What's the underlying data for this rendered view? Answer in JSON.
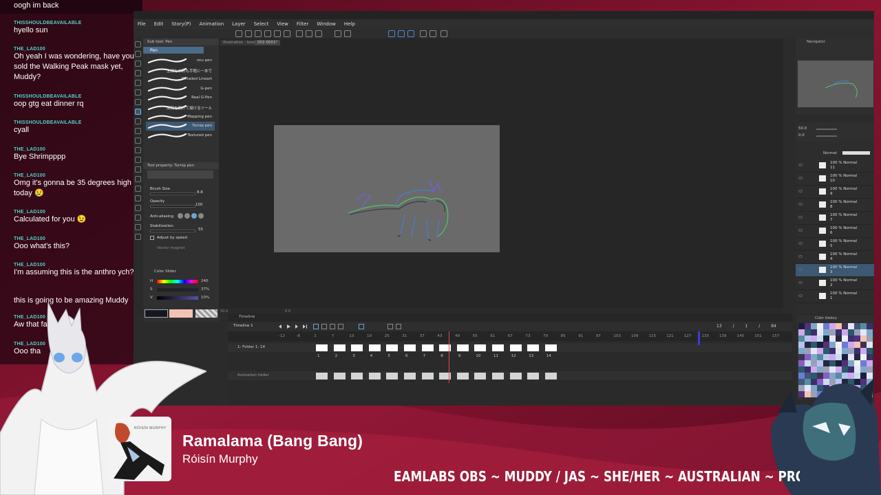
{
  "chat": {
    "messages": [
      {
        "user": "",
        "text": "oogh im back"
      },
      {
        "user": "THISSHOULDBEAVAILABLE",
        "text": "hyello sun"
      },
      {
        "user": "THE_LAD100",
        "text": "Oh yeah I was wondering, have you sold the Walking Peak mask yet, Muddy?"
      },
      {
        "user": "THISSHOULDBEAVAILABLE",
        "text": "oop gtg eat dinner rq"
      },
      {
        "user": "THISSHOULDBEAVAILABLE",
        "text": "cyall"
      },
      {
        "user": "THE_LAD100",
        "text": "Bye Shrimpppp"
      },
      {
        "user": "THE_LAD100",
        "text": "Omg it's gonna be 35 degrees high today 😢"
      },
      {
        "user": "THE_LAD100",
        "text": "Calculated for you 😉"
      },
      {
        "user": "THE_LAD100",
        "text": "Ooo what's this?"
      },
      {
        "user": "THE_LAD100",
        "text": "I'm assuming this is the anthro ych?"
      },
      {
        "user": "",
        "text": "this is going to be amazing Muddy"
      },
      {
        "user": "THE_LAD100",
        "text": "Aw that fa"
      },
      {
        "user": "THE_LAD100",
        "text": "Ooo tha"
      }
    ]
  },
  "app": {
    "menu": [
      "File",
      "Edit",
      "Story(P)",
      "Animation",
      "Layer",
      "Select",
      "View",
      "Filter",
      "Window",
      "Help"
    ],
    "canvas_tabs": [
      "Illustration - bounce",
      "002-0001*"
    ],
    "subtool": {
      "header": "Sub tool: Pen",
      "active": "Pen",
      "brushes": [
        "snu pen",
        "主線も水彩も手軽に一本で",
        "Detailed Lineart",
        "G-pen",
        "Real G-Pen",
        "間隔を開けて描けるツール",
        "Mapping pen",
        "Turnip pen",
        "Textured pen"
      ],
      "selected_brush_index": 7,
      "props_header": "Tool property: Turnip pen",
      "brush_size_label": "Brush Size",
      "brush_size_value": "8.8",
      "opacity_label": "Opacity",
      "opacity_value": "100",
      "antialias_label": "Anti-aliasing",
      "stabilization_label": "Stabilization",
      "stabilization_value": "55",
      "adjust_label": "Adjust by speed",
      "vector_label": "Vector magnet"
    },
    "color_slider": {
      "header": "Color Slider",
      "h_label": "H",
      "h_value": "240",
      "s_label": "S",
      "s_value": "37%",
      "v_label": "V",
      "v_value": "10%"
    },
    "canvas_status": {
      "zoom": "50.0",
      "angle": "0.0"
    },
    "navigator": {
      "header": "Navigator",
      "zoom": "50.0",
      "angle": "0.0"
    },
    "layers": {
      "blend_mode": "Normal",
      "rows": [
        {
          "text": "100 % Normal",
          "name": "11"
        },
        {
          "text": "100 % Normal",
          "name": "10"
        },
        {
          "text": "100 % Normal",
          "name": "9"
        },
        {
          "text": "100 % Normal",
          "name": "8"
        },
        {
          "text": "100 % Normal",
          "name": "7"
        },
        {
          "text": "100 % Normal",
          "name": "6"
        },
        {
          "text": "100 % Normal",
          "name": "5"
        },
        {
          "text": "100 % Normal",
          "name": "4"
        },
        {
          "text": "100 % Normal",
          "name": "3"
        },
        {
          "text": "100 % Normal",
          "name": "2"
        },
        {
          "text": "100 % Normal",
          "name": "1"
        }
      ],
      "selected_index": 8
    },
    "timeline": {
      "tab": "Timeline",
      "name": "Timeline 1",
      "frame_info": [
        "13",
        "/",
        "1",
        "/",
        "84"
      ],
      "ruler": [
        "-12",
        "-6",
        "1",
        "7",
        "13",
        "19",
        "25",
        "31",
        "37",
        "43",
        "49",
        "55",
        "61",
        "67",
        "73",
        "79",
        "85",
        "91",
        "97",
        "103",
        "109",
        "115",
        "121",
        "127",
        "133",
        "139",
        "145",
        "151",
        "157"
      ],
      "track1": "1: Folder 1: 14",
      "track2": "Animation folder",
      "cel_numbers": [
        "1",
        "2",
        "3",
        "4",
        "5",
        "6",
        "7",
        "8",
        "9",
        "10",
        "11",
        "12",
        "13",
        "14"
      ]
    },
    "color_history_header": "Color History"
  },
  "now_playing": {
    "title": "Ramalama (Bang Bang)",
    "artist": "Róisín Murphy",
    "album_label": "RÓISÍN MURPHY"
  },
  "ticker": "EAMLABS OBS ~ MUDDY / JAS ~ SHE/HER ~ AUSTRALIAN ~ PROGRAM:",
  "colors": {
    "background": "#7a0f2c",
    "chat_user": "#4fd3c4",
    "accent_blue": "#3d5873",
    "playhead": "#e14b4b"
  }
}
